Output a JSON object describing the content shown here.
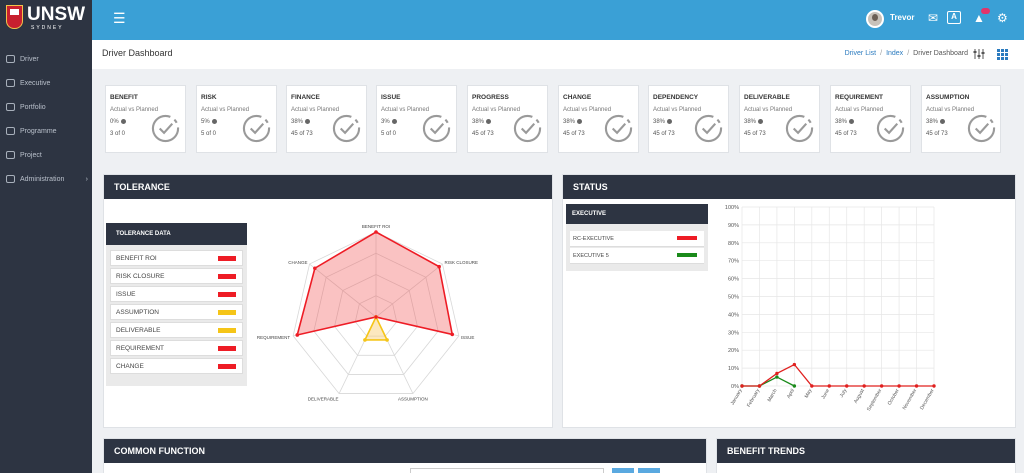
{
  "brand": {
    "name": "UNSW",
    "sub": "SYDNEY"
  },
  "topbar": {
    "user": "Trevor",
    "notification_count": ""
  },
  "sidebar": {
    "items": [
      {
        "label": "Driver",
        "icon": "steering-wheel-icon"
      },
      {
        "label": "Executive",
        "icon": "briefcase-icon"
      },
      {
        "label": "Portfolio",
        "icon": "folder-icon"
      },
      {
        "label": "Programme",
        "icon": "layers-icon"
      },
      {
        "label": "Project",
        "icon": "clipboard-icon"
      },
      {
        "label": "Administration",
        "icon": "user-icon",
        "caret": "›"
      }
    ]
  },
  "header": {
    "title": "Driver Dashboard",
    "breadcrumb": [
      "Driver List",
      "Index",
      "Driver Dashboard"
    ]
  },
  "cards": [
    {
      "title": "BENEFIT",
      "sub": "Actual vs Planned",
      "pct": "0%",
      "count": "3 of 0"
    },
    {
      "title": "RISK",
      "sub": "Actual vs Planned",
      "pct": "5%",
      "count": "5 of 0"
    },
    {
      "title": "FINANCE",
      "sub": "Actual vs Planned",
      "pct": "38%",
      "count": "45 of 73"
    },
    {
      "title": "ISSUE",
      "sub": "Actual vs Planned",
      "pct": "3%",
      "count": "5 of 0"
    },
    {
      "title": "PROGRESS",
      "sub": "Actual vs Planned",
      "pct": "38%",
      "count": "45 of 73"
    },
    {
      "title": "CHANGE",
      "sub": "Actual vs Planned",
      "pct": "38%",
      "count": "45 of 73"
    },
    {
      "title": "DEPENDENCY",
      "sub": "Actual vs Planned",
      "pct": "38%",
      "count": "45 of 73"
    },
    {
      "title": "DELIVERABLE",
      "sub": "Actual vs Planned",
      "pct": "38%",
      "count": "45 of 73"
    },
    {
      "title": "REQUIREMENT",
      "sub": "Actual vs Planned",
      "pct": "38%",
      "count": "45 of 73"
    },
    {
      "title": "ASSUMPTION",
      "sub": "Actual vs Planned",
      "pct": "38%",
      "count": "45 of 73"
    }
  ],
  "tolerance": {
    "title": "TOLERANCE",
    "table_title": "TOLERANCE DATA",
    "rows": [
      {
        "label": "BENEFIT ROI",
        "color": "#ee1c25"
      },
      {
        "label": "RISK CLOSURE",
        "color": "#ee1c25"
      },
      {
        "label": "ISSUE",
        "color": "#ee1c25"
      },
      {
        "label": "ASSUMPTION",
        "color": "#f5c518"
      },
      {
        "label": "DELIVERABLE",
        "color": "#f5c518"
      },
      {
        "label": "REQUIREMENT",
        "color": "#ee1c25"
      },
      {
        "label": "CHANGE",
        "color": "#ee1c25"
      }
    ]
  },
  "status": {
    "title": "STATUS",
    "legend_title": "EXECUTIVE",
    "legend": [
      {
        "label": "RC-EXECUTIVE",
        "color": "#ee1c25"
      },
      {
        "label": "EXECUTIVE 5",
        "color": "#1a8a1a"
      }
    ]
  },
  "bottom": {
    "common_function": "COMMON FUNCTION",
    "benefit_trends": "BENEFIT TRENDS"
  },
  "chart_data": [
    {
      "type": "radar",
      "axes": [
        "BENEFIT ROI",
        "RISK CLOSURE",
        "ISSUE",
        "ASSUMPTION",
        "DELIVERABLE",
        "REQUIREMENT",
        "CHANGE"
      ],
      "rmax": 1,
      "series": [
        {
          "values": [
            1,
            0.95,
            0.92,
            0,
            0,
            0.95,
            0.92
          ],
          "color": "#ee1c25",
          "fill": "rgba(240,80,80,0.35)"
        },
        {
          "values": [
            0,
            0,
            0,
            0.3,
            0.3,
            0,
            0
          ],
          "color": "#f5c518",
          "fill": "rgba(248,205,110,0.45)"
        }
      ]
    },
    {
      "type": "line",
      "x": [
        "January",
        "February",
        "March",
        "April",
        "May",
        "June",
        "July",
        "August",
        "September",
        "October",
        "November",
        "December"
      ],
      "yticks": [
        "0%",
        "10%",
        "20%",
        "30%",
        "40%",
        "50%",
        "60%",
        "70%",
        "80%",
        "90%",
        "100%"
      ],
      "ylim": [
        0,
        100
      ],
      "series": [
        {
          "name": "RC-EXECUTIVE",
          "color": "#e0201f",
          "values": [
            0,
            0,
            7,
            12,
            0,
            0,
            0,
            0,
            0,
            0,
            0,
            0
          ]
        },
        {
          "name": "EXECUTIVE 5",
          "color": "#1a8a1a",
          "values": [
            0,
            0,
            5,
            0,
            null,
            null,
            null,
            null,
            null,
            null,
            null,
            null
          ]
        }
      ]
    }
  ]
}
